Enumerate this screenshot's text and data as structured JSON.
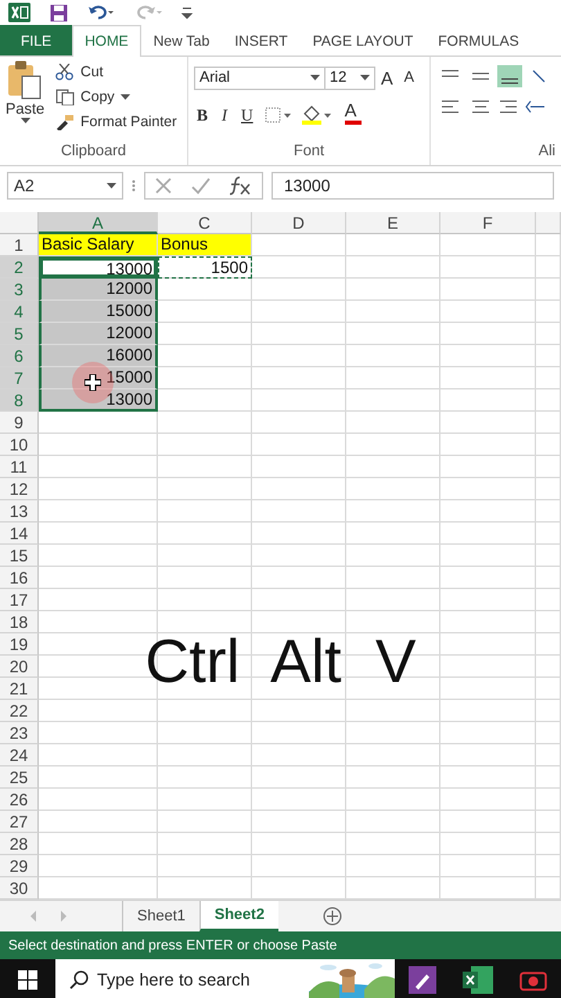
{
  "menu_tabs": [
    {
      "label": "FILE",
      "kind": "file",
      "selected": false
    },
    {
      "label": "HOME",
      "kind": "tab",
      "selected": true
    },
    {
      "label": "New Tab",
      "kind": "tab",
      "selected": false
    },
    {
      "label": "INSERT",
      "kind": "tab",
      "selected": false
    },
    {
      "label": "PAGE LAYOUT",
      "kind": "tab",
      "selected": false
    },
    {
      "label": "FORMULAS",
      "kind": "tab",
      "selected": false
    }
  ],
  "clipboard": {
    "paste": "Paste",
    "cut": "Cut",
    "copy": "Copy",
    "format_painter": "Format Painter",
    "label": "Clipboard"
  },
  "font": {
    "name": "Arial",
    "size": "12",
    "size_buttons": [
      "A",
      "A"
    ],
    "style_buttons": [
      "B",
      "I",
      "U"
    ],
    "font_color": "A",
    "label": "Font"
  },
  "alignment": {
    "label": "Ali"
  },
  "formula_bar": {
    "name_box": "A2",
    "value": "13000"
  },
  "columns": [
    {
      "label": "A",
      "selected": true
    },
    {
      "label": "C",
      "selected": false
    },
    {
      "label": "D",
      "selected": false
    },
    {
      "label": "E",
      "selected": false
    },
    {
      "label": "F",
      "selected": false
    }
  ],
  "rows": [
    {
      "number": "1",
      "selected": false,
      "cells": [
        {
          "text": "Basic Salary",
          "kind": "header",
          "selected": false,
          "copied": false
        },
        {
          "text": "Bonus",
          "kind": "header",
          "selected": false,
          "copied": false
        }
      ]
    },
    {
      "number": "2",
      "selected": true,
      "cells": [
        {
          "text": "13000",
          "kind": "value",
          "selected": true,
          "copied": false
        },
        {
          "text": "1500",
          "kind": "value",
          "selected": false,
          "copied": true
        }
      ]
    },
    {
      "number": "3",
      "selected": true,
      "cells": [
        {
          "text": "12000",
          "kind": "value",
          "selected": true,
          "copied": false
        }
      ]
    },
    {
      "number": "4",
      "selected": true,
      "cells": [
        {
          "text": "15000",
          "kind": "value",
          "selected": true,
          "copied": false
        }
      ]
    },
    {
      "number": "5",
      "selected": true,
      "cells": [
        {
          "text": "12000",
          "kind": "value",
          "selected": true,
          "copied": false
        }
      ]
    },
    {
      "number": "6",
      "selected": true,
      "cells": [
        {
          "text": "16000",
          "kind": "value",
          "selected": true,
          "copied": false
        }
      ]
    },
    {
      "number": "7",
      "selected": true,
      "cells": [
        {
          "text": "15000",
          "kind": "value",
          "selected": true,
          "copied": false
        }
      ]
    },
    {
      "number": "8",
      "selected": true,
      "cells": [
        {
          "text": "13000",
          "kind": "value",
          "selected": true,
          "copied": false
        }
      ]
    },
    {
      "number": "9",
      "selected": false
    },
    {
      "number": "10",
      "selected": false
    },
    {
      "number": "11",
      "selected": false
    },
    {
      "number": "12",
      "selected": false
    },
    {
      "number": "13",
      "selected": false
    },
    {
      "number": "14",
      "selected": false
    },
    {
      "number": "15",
      "selected": false
    },
    {
      "number": "16",
      "selected": false
    },
    {
      "number": "17",
      "selected": false
    },
    {
      "number": "18",
      "selected": false
    },
    {
      "number": "19",
      "selected": false
    },
    {
      "number": "20",
      "selected": false
    },
    {
      "number": "21",
      "selected": false
    },
    {
      "number": "22",
      "selected": false
    },
    {
      "number": "23",
      "selected": false
    },
    {
      "number": "24",
      "selected": false
    },
    {
      "number": "25",
      "selected": false
    },
    {
      "number": "26",
      "selected": false
    },
    {
      "number": "27",
      "selected": false
    },
    {
      "number": "28",
      "selected": false
    },
    {
      "number": "29",
      "selected": false
    },
    {
      "number": "30",
      "selected": false
    }
  ],
  "caption": "Ctrl  Alt  V",
  "sheet_tabs": [
    {
      "label": "Sheet1",
      "selected": false
    },
    {
      "label": "Sheet2",
      "selected": true
    }
  ],
  "status_bar": "Select destination and press ENTER or choose Paste",
  "taskbar": {
    "search": {
      "placeholder": "Type here to search"
    }
  }
}
